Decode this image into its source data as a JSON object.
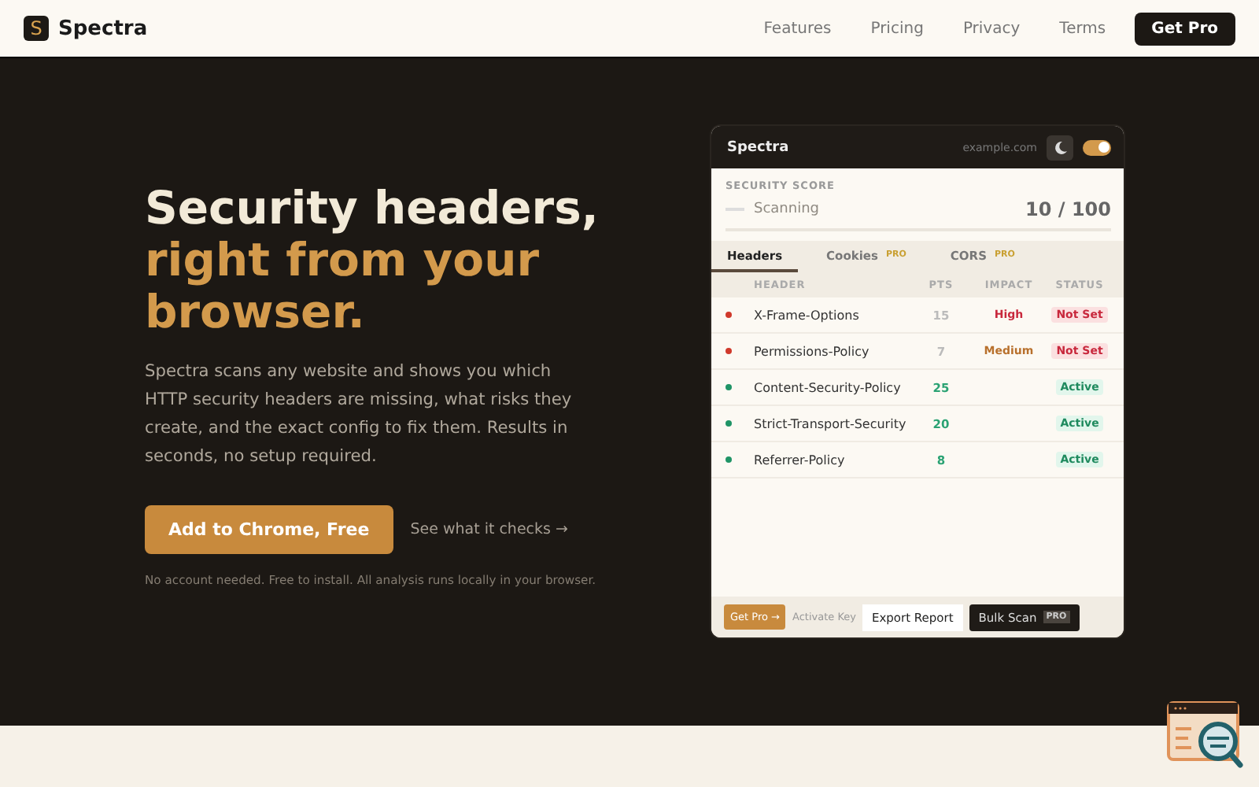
{
  "nav": {
    "logo_letter": "S",
    "brand": "Spectra",
    "links": [
      "Features",
      "Pricing",
      "Privacy",
      "Terms"
    ],
    "cta": "Get Pro"
  },
  "hero": {
    "title_line": "Security headers,",
    "title_accent": "right from your browser.",
    "lead": "Spectra scans any website and shows you which HTTP security headers are missing, what risks they create, and the exact config to fix them. Results in seconds, no setup required.",
    "primary_button": "Add to Chrome, Free",
    "secondary_link": "See what it checks →",
    "note": "No account needed. Free to install. All analysis runs locally in your browser."
  },
  "popup": {
    "title": "Spectra",
    "domain": "example.com",
    "theme_toggle": {
      "on": true
    },
    "score": {
      "label": "SECURITY SCORE",
      "status": "Scanning",
      "value": "10 / 100"
    },
    "tabs": [
      {
        "label": "Headers",
        "selected": true
      },
      {
        "label": "Cookies",
        "badge": "PRO",
        "selected": false
      },
      {
        "label": "CORS",
        "badge": "PRO",
        "selected": false
      }
    ],
    "columns": [
      "HEADER",
      "PTS",
      "IMPACT",
      "STATUS"
    ],
    "rows": [
      {
        "kind": "missing",
        "header": "X-Frame-Options",
        "pts": "15",
        "impact": "High",
        "status": "Not Set"
      },
      {
        "kind": "missing",
        "header": "Permissions-Policy",
        "pts": "7",
        "impact": "Medium",
        "status": "Not Set"
      },
      {
        "kind": "active",
        "header": "Content-Security-Policy",
        "pts": "25",
        "status": "Active"
      },
      {
        "kind": "active",
        "header": "Strict-Transport-Security",
        "pts": "20",
        "status": "Active"
      },
      {
        "kind": "active",
        "header": "Referrer-Policy",
        "pts": "8",
        "status": "Active"
      }
    ],
    "footer": {
      "get_pro": "Get Pro →",
      "activate": "Activate Key",
      "export": "Export Report",
      "bulk": "Bulk Scan",
      "bulk_badge": "PRO"
    }
  }
}
